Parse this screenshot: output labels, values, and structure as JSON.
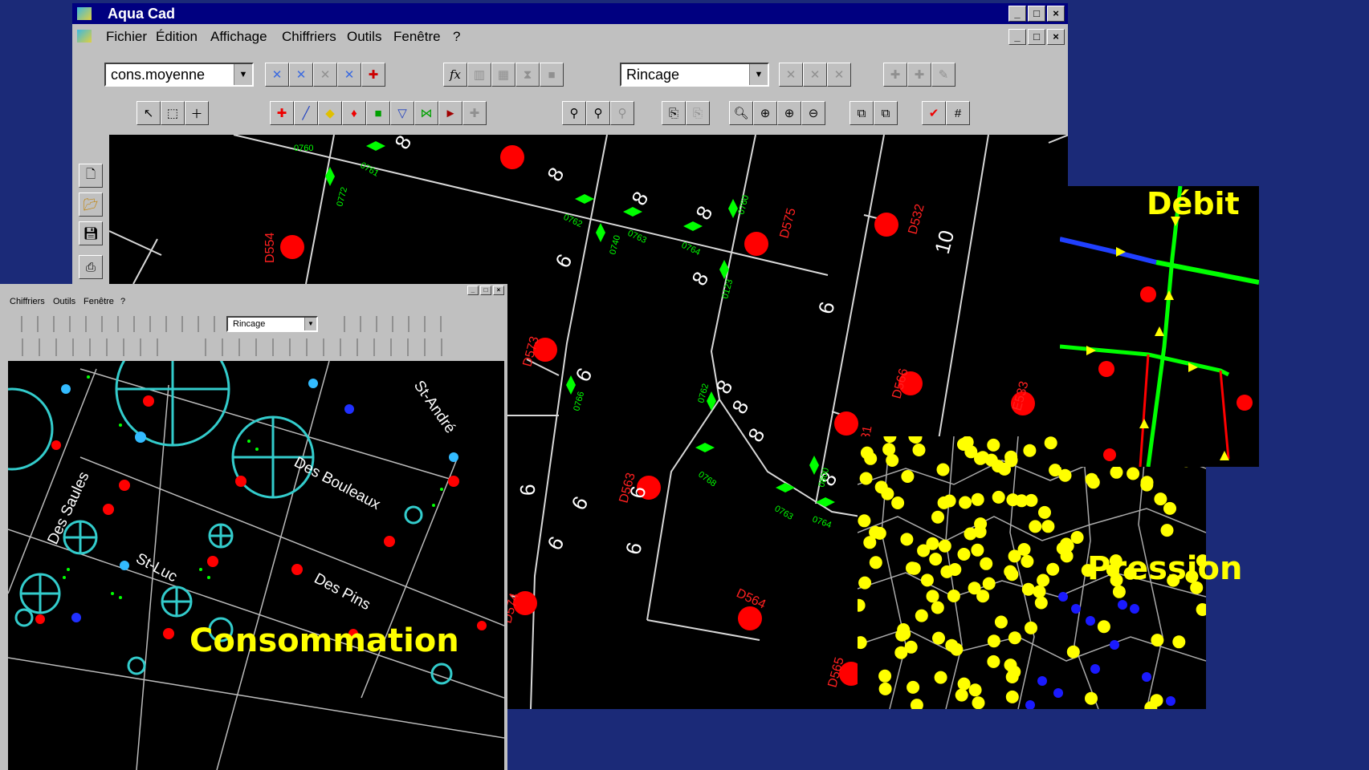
{
  "main_window": {
    "title": "Aqua Cad",
    "menu": [
      "Fichier",
      "Édition",
      "Affichage",
      "Chiffriers",
      "Outils",
      "Fenêtre",
      "?"
    ],
    "combo_left": "cons.moyenne",
    "combo_right": "Rincage",
    "fx_label": "fx",
    "window_buttons": [
      "_",
      "□",
      "×"
    ]
  },
  "small_window": {
    "menu": [
      "Chiffriers",
      "Outils",
      "Fenêtre",
      "?"
    ],
    "combo": "Rincage"
  },
  "map_main": {
    "pipe_labels": [
      "8",
      "8",
      "8",
      "8",
      "6",
      "8",
      "6",
      "6",
      "8",
      "8",
      "8",
      "6",
      "10",
      "6",
      "6",
      "6",
      "6",
      "6",
      "8",
      "4",
      "6"
    ],
    "hydrant_labels": [
      "D554",
      "D575",
      "D532",
      "D573",
      "D566",
      "E533",
      "D563",
      "D564",
      "D574",
      "D565",
      "531"
    ],
    "valve_labels": [
      "0760",
      "0761",
      "0772",
      "0762",
      "0763",
      "0764",
      "0760",
      "0740",
      "0123",
      "0762",
      "0766",
      "0768",
      "0763",
      "0764",
      "0800"
    ]
  },
  "map_consommation": {
    "streets": [
      "St-André",
      "Des Bouleaux",
      "Des Saules",
      "St-Luc",
      "Des Pins"
    ]
  },
  "captions": {
    "debit": "Débit",
    "pression": "Pression",
    "consommation": "Consommation"
  },
  "colors": {
    "background": "#1b2a78",
    "caption": "#ffff00",
    "hydrant": "#ff0000",
    "valve": "#00ff00",
    "node": "#ffff00",
    "consumer": "#33cccc"
  }
}
